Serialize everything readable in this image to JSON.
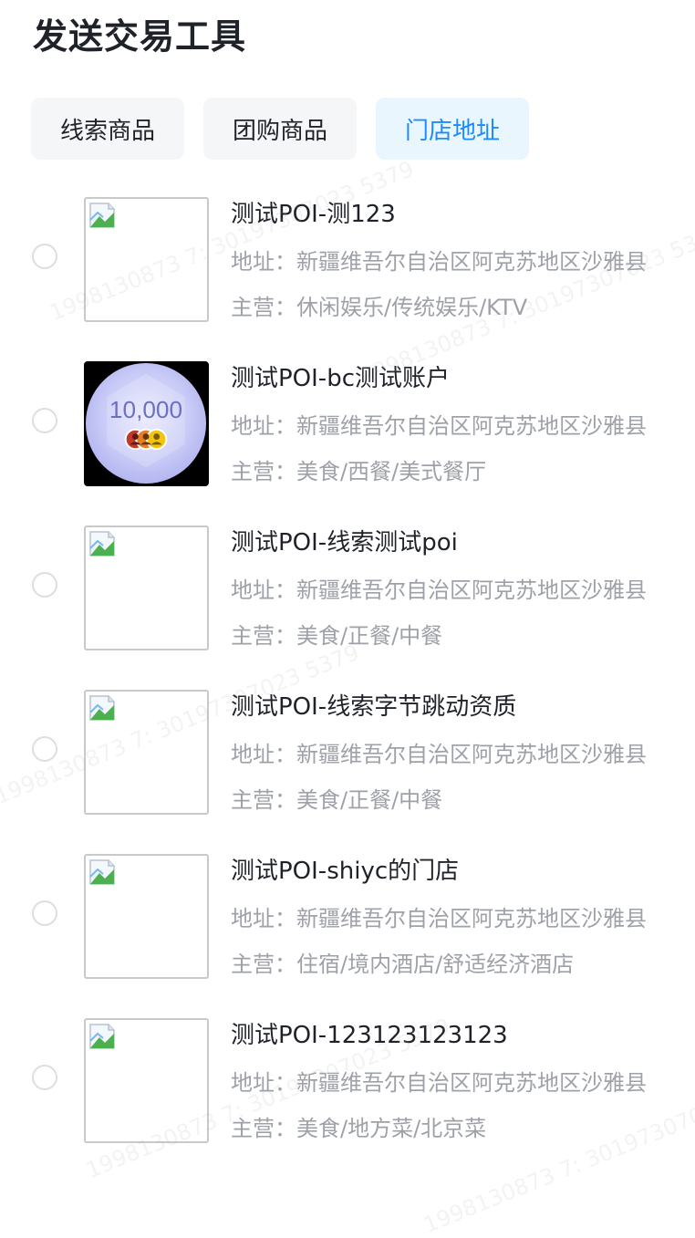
{
  "page_title": "发送交易工具",
  "tabs": [
    {
      "label": "线索商品",
      "active": false
    },
    {
      "label": "团购商品",
      "active": false
    },
    {
      "label": "门店地址",
      "active": true
    }
  ],
  "poi_list": [
    {
      "name": "测试POI-测123",
      "address": "地址：新疆维吾尔自治区阿克苏地区沙雅县",
      "business": "主营：休闲娱乐/传统娱乐/KTV",
      "image": "broken-image"
    },
    {
      "name": "测试POI-bc测试账户",
      "address": "地址：新疆维吾尔自治区阿克苏地区沙雅县",
      "business": "主营：美食/西餐/美式餐厅",
      "image": "logo",
      "logo_text": "10,000"
    },
    {
      "name": "测试POI-线索测试poi",
      "address": "地址：新疆维吾尔自治区阿克苏地区沙雅县",
      "business": "主营：美食/正餐/中餐",
      "image": "broken-image"
    },
    {
      "name": "测试POI-线索字节跳动资质",
      "address": "地址：新疆维吾尔自治区阿克苏地区沙雅县",
      "business": "主营：美食/正餐/中餐",
      "image": "broken-image"
    },
    {
      "name": "测试POI-shiyc的门店",
      "address": "地址：新疆维吾尔自治区阿克苏地区沙雅县",
      "business": "主营：住宿/境内酒店/舒适经济酒店",
      "image": "broken-image"
    },
    {
      "name": "测试POI-123123123123",
      "address": "地址：新疆维吾尔自治区阿克苏地区沙雅县",
      "business": "主营：美食/地方菜/北京菜",
      "image": "broken-image"
    }
  ],
  "watermark_text": "1998130873 7: 30197307023 5379",
  "colors": {
    "accent": "#1a8cff",
    "active_tab_bg": "#eaf6fd",
    "tab_bg": "#f5f6f7",
    "meta_text": "#9ea2a8",
    "title_text": "#1f2329"
  }
}
